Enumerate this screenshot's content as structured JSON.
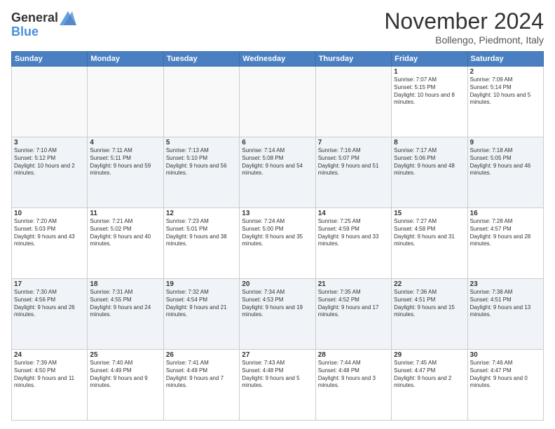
{
  "header": {
    "logo_line1": "General",
    "logo_line2": "Blue",
    "month": "November 2024",
    "location": "Bollengo, Piedmont, Italy"
  },
  "weekdays": [
    "Sunday",
    "Monday",
    "Tuesday",
    "Wednesday",
    "Thursday",
    "Friday",
    "Saturday"
  ],
  "weeks": [
    [
      {
        "day": "",
        "info": ""
      },
      {
        "day": "",
        "info": ""
      },
      {
        "day": "",
        "info": ""
      },
      {
        "day": "",
        "info": ""
      },
      {
        "day": "",
        "info": ""
      },
      {
        "day": "1",
        "info": "Sunrise: 7:07 AM\nSunset: 5:15 PM\nDaylight: 10 hours and 8 minutes."
      },
      {
        "day": "2",
        "info": "Sunrise: 7:09 AM\nSunset: 5:14 PM\nDaylight: 10 hours and 5 minutes."
      }
    ],
    [
      {
        "day": "3",
        "info": "Sunrise: 7:10 AM\nSunset: 5:12 PM\nDaylight: 10 hours and 2 minutes."
      },
      {
        "day": "4",
        "info": "Sunrise: 7:11 AM\nSunset: 5:11 PM\nDaylight: 9 hours and 59 minutes."
      },
      {
        "day": "5",
        "info": "Sunrise: 7:13 AM\nSunset: 5:10 PM\nDaylight: 9 hours and 56 minutes."
      },
      {
        "day": "6",
        "info": "Sunrise: 7:14 AM\nSunset: 5:08 PM\nDaylight: 9 hours and 54 minutes."
      },
      {
        "day": "7",
        "info": "Sunrise: 7:16 AM\nSunset: 5:07 PM\nDaylight: 9 hours and 51 minutes."
      },
      {
        "day": "8",
        "info": "Sunrise: 7:17 AM\nSunset: 5:06 PM\nDaylight: 9 hours and 48 minutes."
      },
      {
        "day": "9",
        "info": "Sunrise: 7:18 AM\nSunset: 5:05 PM\nDaylight: 9 hours and 46 minutes."
      }
    ],
    [
      {
        "day": "10",
        "info": "Sunrise: 7:20 AM\nSunset: 5:03 PM\nDaylight: 9 hours and 43 minutes."
      },
      {
        "day": "11",
        "info": "Sunrise: 7:21 AM\nSunset: 5:02 PM\nDaylight: 9 hours and 40 minutes."
      },
      {
        "day": "12",
        "info": "Sunrise: 7:23 AM\nSunset: 5:01 PM\nDaylight: 9 hours and 38 minutes."
      },
      {
        "day": "13",
        "info": "Sunrise: 7:24 AM\nSunset: 5:00 PM\nDaylight: 9 hours and 35 minutes."
      },
      {
        "day": "14",
        "info": "Sunrise: 7:25 AM\nSunset: 4:59 PM\nDaylight: 9 hours and 33 minutes."
      },
      {
        "day": "15",
        "info": "Sunrise: 7:27 AM\nSunset: 4:58 PM\nDaylight: 9 hours and 31 minutes."
      },
      {
        "day": "16",
        "info": "Sunrise: 7:28 AM\nSunset: 4:57 PM\nDaylight: 9 hours and 28 minutes."
      }
    ],
    [
      {
        "day": "17",
        "info": "Sunrise: 7:30 AM\nSunset: 4:56 PM\nDaylight: 9 hours and 26 minutes."
      },
      {
        "day": "18",
        "info": "Sunrise: 7:31 AM\nSunset: 4:55 PM\nDaylight: 9 hours and 24 minutes."
      },
      {
        "day": "19",
        "info": "Sunrise: 7:32 AM\nSunset: 4:54 PM\nDaylight: 9 hours and 21 minutes."
      },
      {
        "day": "20",
        "info": "Sunrise: 7:34 AM\nSunset: 4:53 PM\nDaylight: 9 hours and 19 minutes."
      },
      {
        "day": "21",
        "info": "Sunrise: 7:35 AM\nSunset: 4:52 PM\nDaylight: 9 hours and 17 minutes."
      },
      {
        "day": "22",
        "info": "Sunrise: 7:36 AM\nSunset: 4:51 PM\nDaylight: 9 hours and 15 minutes."
      },
      {
        "day": "23",
        "info": "Sunrise: 7:38 AM\nSunset: 4:51 PM\nDaylight: 9 hours and 13 minutes."
      }
    ],
    [
      {
        "day": "24",
        "info": "Sunrise: 7:39 AM\nSunset: 4:50 PM\nDaylight: 9 hours and 11 minutes."
      },
      {
        "day": "25",
        "info": "Sunrise: 7:40 AM\nSunset: 4:49 PM\nDaylight: 9 hours and 9 minutes."
      },
      {
        "day": "26",
        "info": "Sunrise: 7:41 AM\nSunset: 4:49 PM\nDaylight: 9 hours and 7 minutes."
      },
      {
        "day": "27",
        "info": "Sunrise: 7:43 AM\nSunset: 4:48 PM\nDaylight: 9 hours and 5 minutes."
      },
      {
        "day": "28",
        "info": "Sunrise: 7:44 AM\nSunset: 4:48 PM\nDaylight: 9 hours and 3 minutes."
      },
      {
        "day": "29",
        "info": "Sunrise: 7:45 AM\nSunset: 4:47 PM\nDaylight: 9 hours and 2 minutes."
      },
      {
        "day": "30",
        "info": "Sunrise: 7:46 AM\nSunset: 4:47 PM\nDaylight: 9 hours and 0 minutes."
      }
    ]
  ]
}
